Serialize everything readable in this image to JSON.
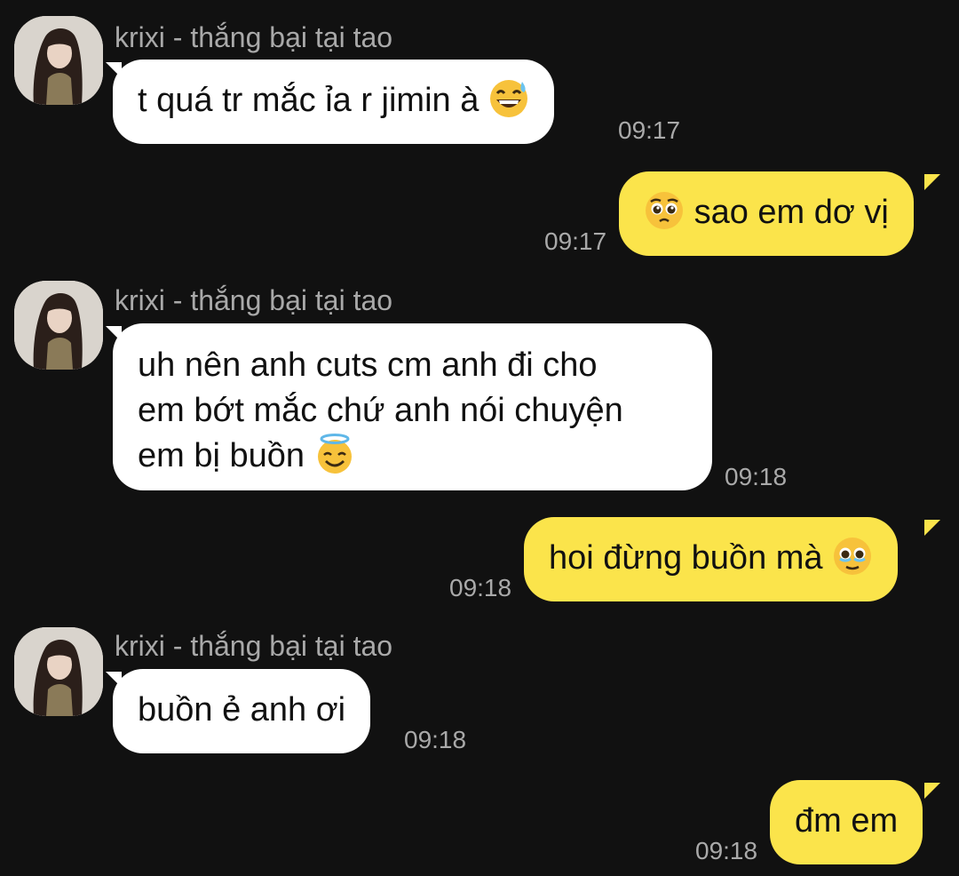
{
  "messages": [
    {
      "direction": "incoming",
      "sender": "krixi - thắng bại tại tao",
      "text": "t quá tr mắc ỉa r jimin à",
      "emoji": "grinning-sweat-emoji",
      "time": "09:17"
    },
    {
      "direction": "outgoing",
      "text": "sao em dơ vị",
      "emoji": "pleading-face-emoji",
      "time": "09:17"
    },
    {
      "direction": "incoming",
      "sender": "krixi - thắng bại tại tao",
      "lines": [
        "uh nên anh cuts cm anh đi cho",
        "em bớt mắc chứ anh nói chuyện",
        "em bị buồn"
      ],
      "emoji": "halo-face-emoji",
      "time": "09:18"
    },
    {
      "direction": "outgoing",
      "text": "hoi đừng buồn mà",
      "emoji": "teary-face-emoji",
      "time": "09:18"
    },
    {
      "direction": "incoming",
      "sender": "krixi - thắng bại tại tao",
      "text": "buồn ẻ anh ơi",
      "time": "09:18"
    },
    {
      "direction": "outgoing",
      "text": "đm em",
      "time": "09:18"
    }
  ],
  "colors": {
    "background": "#111111",
    "incoming_bubble": "#ffffff",
    "outgoing_bubble": "#fbe44b",
    "meta_text": "#a9a9a9"
  }
}
